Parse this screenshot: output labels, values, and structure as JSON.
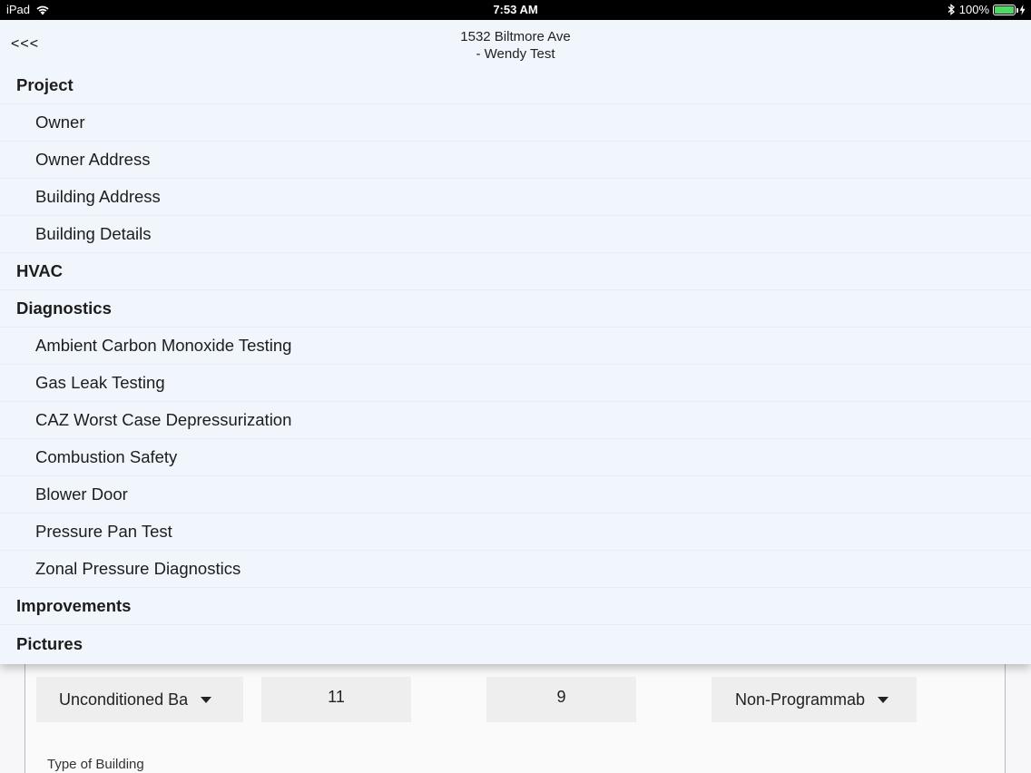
{
  "status_bar": {
    "device": "iPad",
    "time": "7:53 AM",
    "battery_percent": "100%",
    "battery_level": 1.0
  },
  "header": {
    "back_label": "<<<",
    "title_line1": "1532 Biltmore Ave",
    "title_line2": "-  Wendy Test"
  },
  "menu": {
    "project": {
      "label": "Project",
      "items": [
        "Owner",
        "Owner Address",
        "Building Address",
        "Building Details"
      ]
    },
    "hvac": {
      "label": "HVAC"
    },
    "diagnostics": {
      "label": "Diagnostics",
      "items": [
        "Ambient Carbon Monoxide Testing",
        "Gas Leak Testing",
        "CAZ Worst Case Depressurization",
        "Combustion Safety",
        "Blower Door",
        "Pressure Pan Test",
        "Zonal Pressure Diagnostics"
      ]
    },
    "improvements": {
      "label": "Improvements"
    },
    "pictures": {
      "label": "Pictures"
    }
  },
  "background_form": {
    "select_1_value": "Unconditioned Ba",
    "number_1_value": "11",
    "number_2_value": "9",
    "select_2_value": "Non-Programmab",
    "type_of_building_label": "Type of Building"
  },
  "colors": {
    "overlay_bg": "#f0f6fc",
    "battery_green": "#4cd964"
  }
}
